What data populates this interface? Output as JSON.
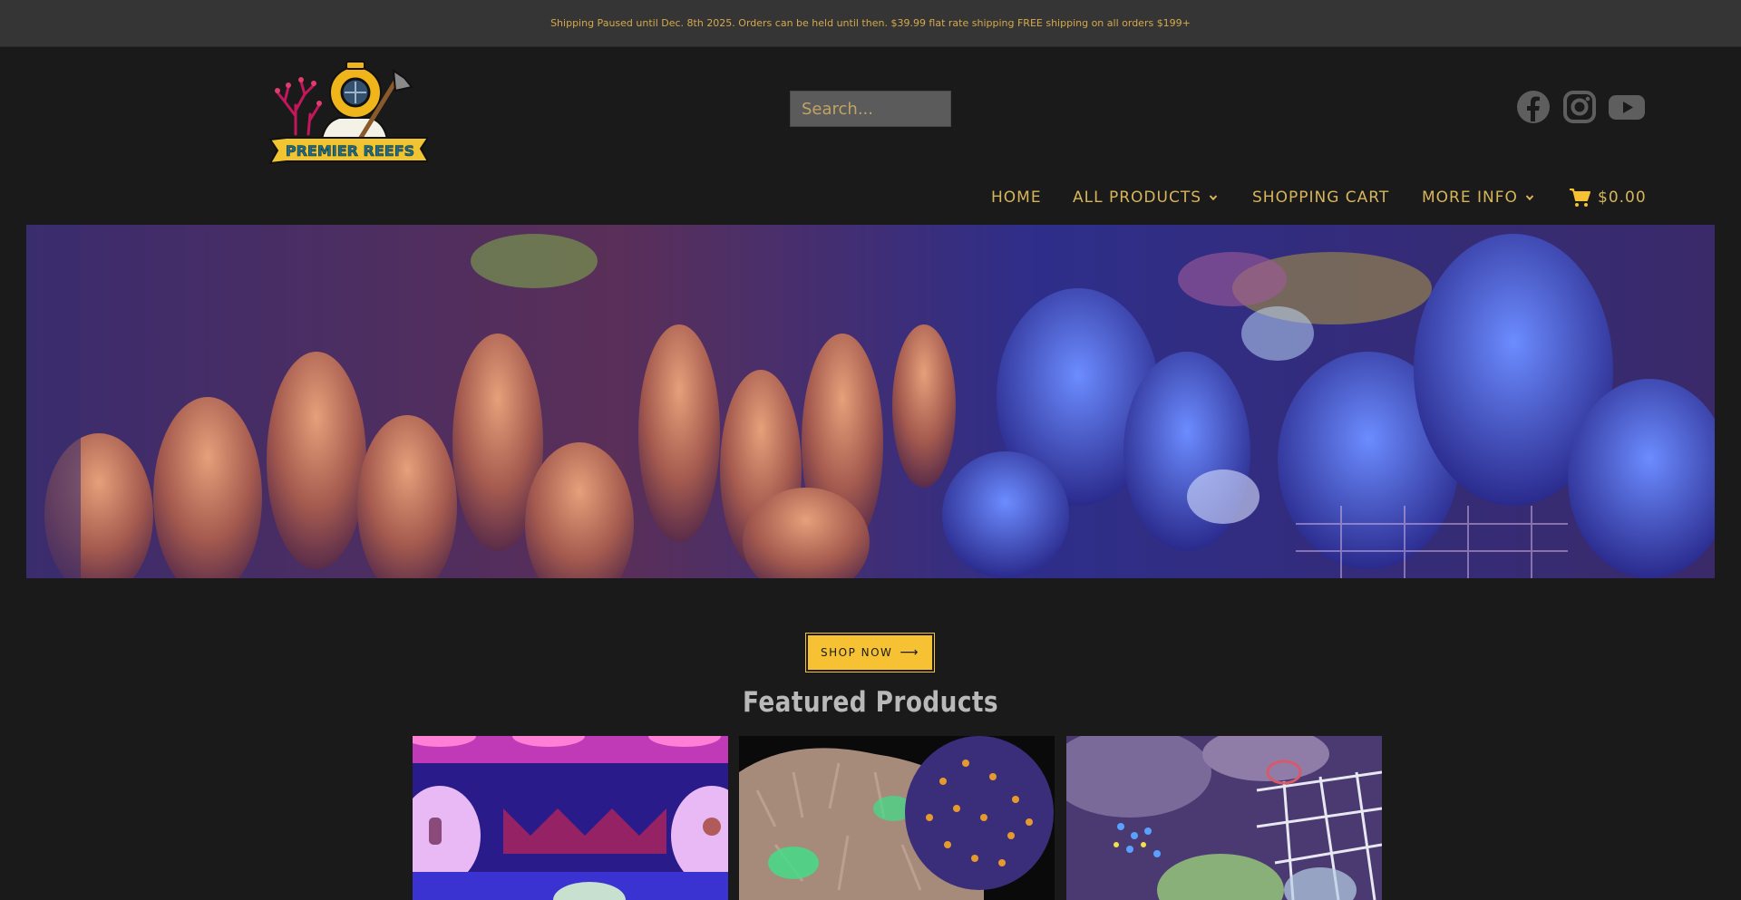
{
  "announcement": "Shipping Paused until Dec. 8th 2025. Orders can be held until then. $39.99 flat rate shipping FREE shipping on all orders $199+",
  "logo": {
    "text": "PREMIER REEFS"
  },
  "search": {
    "placeholder": "Search..."
  },
  "social": [
    "facebook-icon",
    "instagram-icon",
    "youtube-icon"
  ],
  "nav": {
    "home": "HOME",
    "all_products": "ALL PRODUCTS",
    "shopping_cart": "SHOPPING CART",
    "more_info": "MORE INFO",
    "cart_total": "$0.00"
  },
  "cta": {
    "label": "SHOP NOW",
    "arrow": "⟶"
  },
  "featured": {
    "heading": "Featured Products"
  },
  "colors": {
    "accent": "#f6c233",
    "nav_text": "#d7b55a",
    "background": "#1a1a1a",
    "topbar": "#353535"
  }
}
